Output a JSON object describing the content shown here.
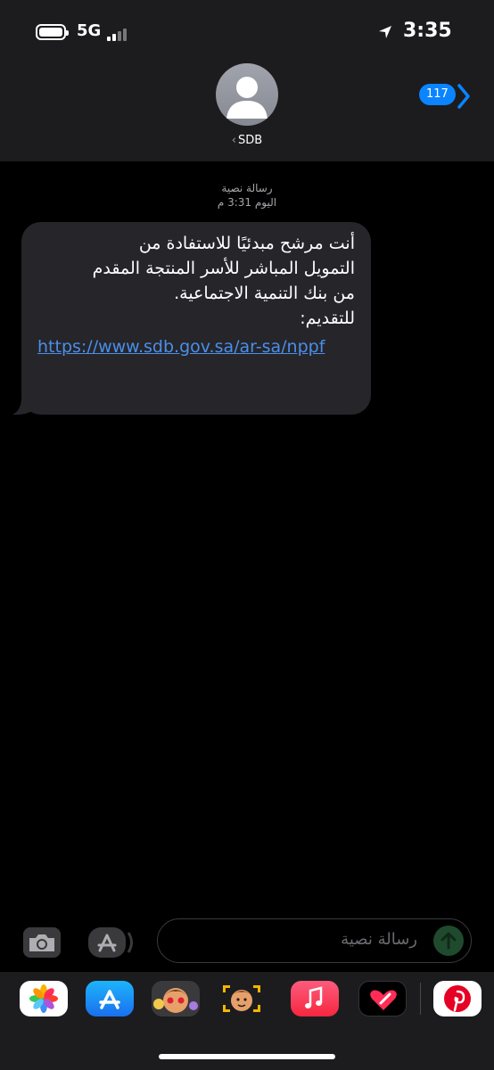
{
  "status_bar": {
    "network": "5G",
    "time": "3:35"
  },
  "header": {
    "contact_name": "SDB",
    "back_chevron": "‹",
    "unread_count": "117"
  },
  "message": {
    "type_label": "رسالة نصية",
    "timestamp": "اليوم 3:31 م",
    "text": "أنت مرشح مبدئيًا للاستفادة من\nالتمويل المباشر للأسر المنتجة المقدم\nمن بنك التنمية الاجتماعية.\nللتقديم:",
    "link": "https://www.sdb.gov.sa/ar-sa/nppf"
  },
  "composer": {
    "placeholder": "رسالة نصية"
  },
  "app_tray": {
    "apps": [
      "photos-app",
      "app-store-app",
      "memoji-stickers-app",
      "memoji-app",
      "music-app",
      "digital-touch-app",
      "pinterest-app"
    ]
  },
  "colors": {
    "accent": "#0a84ff",
    "link": "#4a8fe8",
    "bubble": "#26252a",
    "header_bg": "#1c1c1e"
  }
}
